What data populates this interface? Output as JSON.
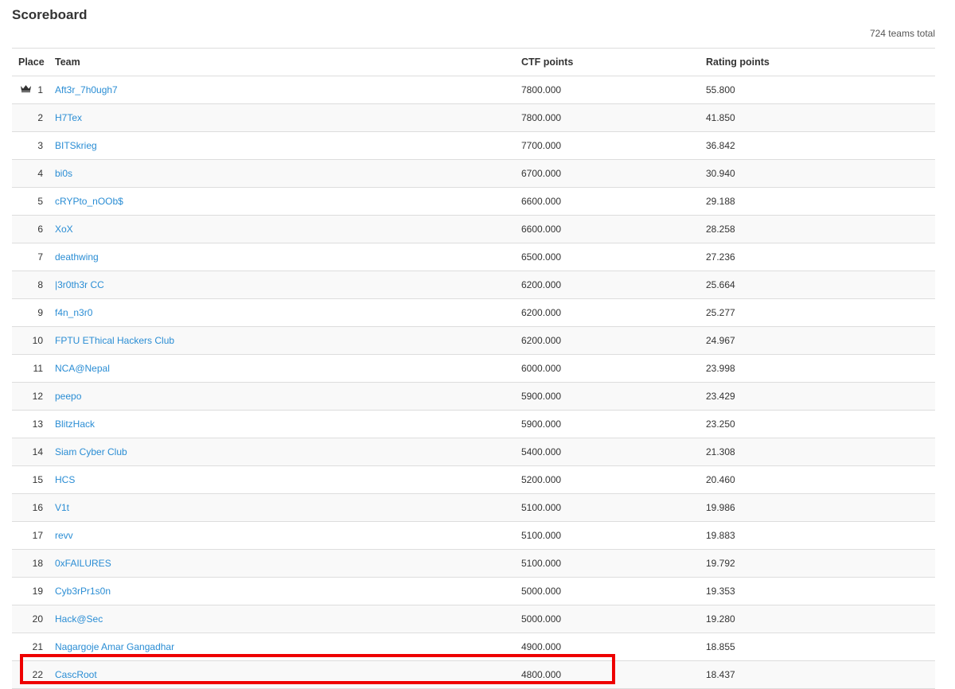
{
  "page": {
    "title": "Scoreboard",
    "teams_total": "724 teams total"
  },
  "table": {
    "headers": {
      "place": "Place",
      "team": "Team",
      "ctf_points": "CTF points",
      "rating_points": "Rating points"
    },
    "rows": [
      {
        "place": "1",
        "team": "Aft3r_7h0ugh7",
        "ctf": "7800.000",
        "rating": "55.800"
      },
      {
        "place": "2",
        "team": "H7Tex",
        "ctf": "7800.000",
        "rating": "41.850"
      },
      {
        "place": "3",
        "team": "BITSkrieg",
        "ctf": "7700.000",
        "rating": "36.842"
      },
      {
        "place": "4",
        "team": "bi0s",
        "ctf": "6700.000",
        "rating": "30.940"
      },
      {
        "place": "5",
        "team": "cRYPto_nOOb$",
        "ctf": "6600.000",
        "rating": "29.188"
      },
      {
        "place": "6",
        "team": "XoX",
        "ctf": "6600.000",
        "rating": "28.258"
      },
      {
        "place": "7",
        "team": "deathwing",
        "ctf": "6500.000",
        "rating": "27.236"
      },
      {
        "place": "8",
        "team": "|3r0th3r CC",
        "ctf": "6200.000",
        "rating": "25.664"
      },
      {
        "place": "9",
        "team": "f4n_n3r0",
        "ctf": "6200.000",
        "rating": "25.277"
      },
      {
        "place": "10",
        "team": "FPTU EThical Hackers Club",
        "ctf": "6200.000",
        "rating": "24.967"
      },
      {
        "place": "11",
        "team": "NCA@Nepal",
        "ctf": "6000.000",
        "rating": "23.998"
      },
      {
        "place": "12",
        "team": "peepo",
        "ctf": "5900.000",
        "rating": "23.429"
      },
      {
        "place": "13",
        "team": "BlitzHack",
        "ctf": "5900.000",
        "rating": "23.250"
      },
      {
        "place": "14",
        "team": "Siam Cyber Club",
        "ctf": "5400.000",
        "rating": "21.308"
      },
      {
        "place": "15",
        "team": "HCS",
        "ctf": "5200.000",
        "rating": "20.460"
      },
      {
        "place": "16",
        "team": "V1t",
        "ctf": "5100.000",
        "rating": "19.986"
      },
      {
        "place": "17",
        "team": "revv",
        "ctf": "5100.000",
        "rating": "19.883"
      },
      {
        "place": "18",
        "team": "0xFAILURES",
        "ctf": "5100.000",
        "rating": "19.792"
      },
      {
        "place": "19",
        "team": "Cyb3rPr1s0n",
        "ctf": "5000.000",
        "rating": "19.353"
      },
      {
        "place": "20",
        "team": "Hack@Sec",
        "ctf": "5000.000",
        "rating": "19.280"
      },
      {
        "place": "21",
        "team": "Nagargoje Amar Gangadhar",
        "ctf": "4900.000",
        "rating": "18.855"
      },
      {
        "place": "22",
        "team": "CascRoot",
        "ctf": "4800.000",
        "rating": "18.437"
      }
    ]
  },
  "icons": {
    "winner": "crown-icon"
  },
  "colors": {
    "link": "#2a8dd4",
    "highlight": "#ee0000",
    "stripe": "#f9f9f9",
    "border": "#dddddd"
  }
}
